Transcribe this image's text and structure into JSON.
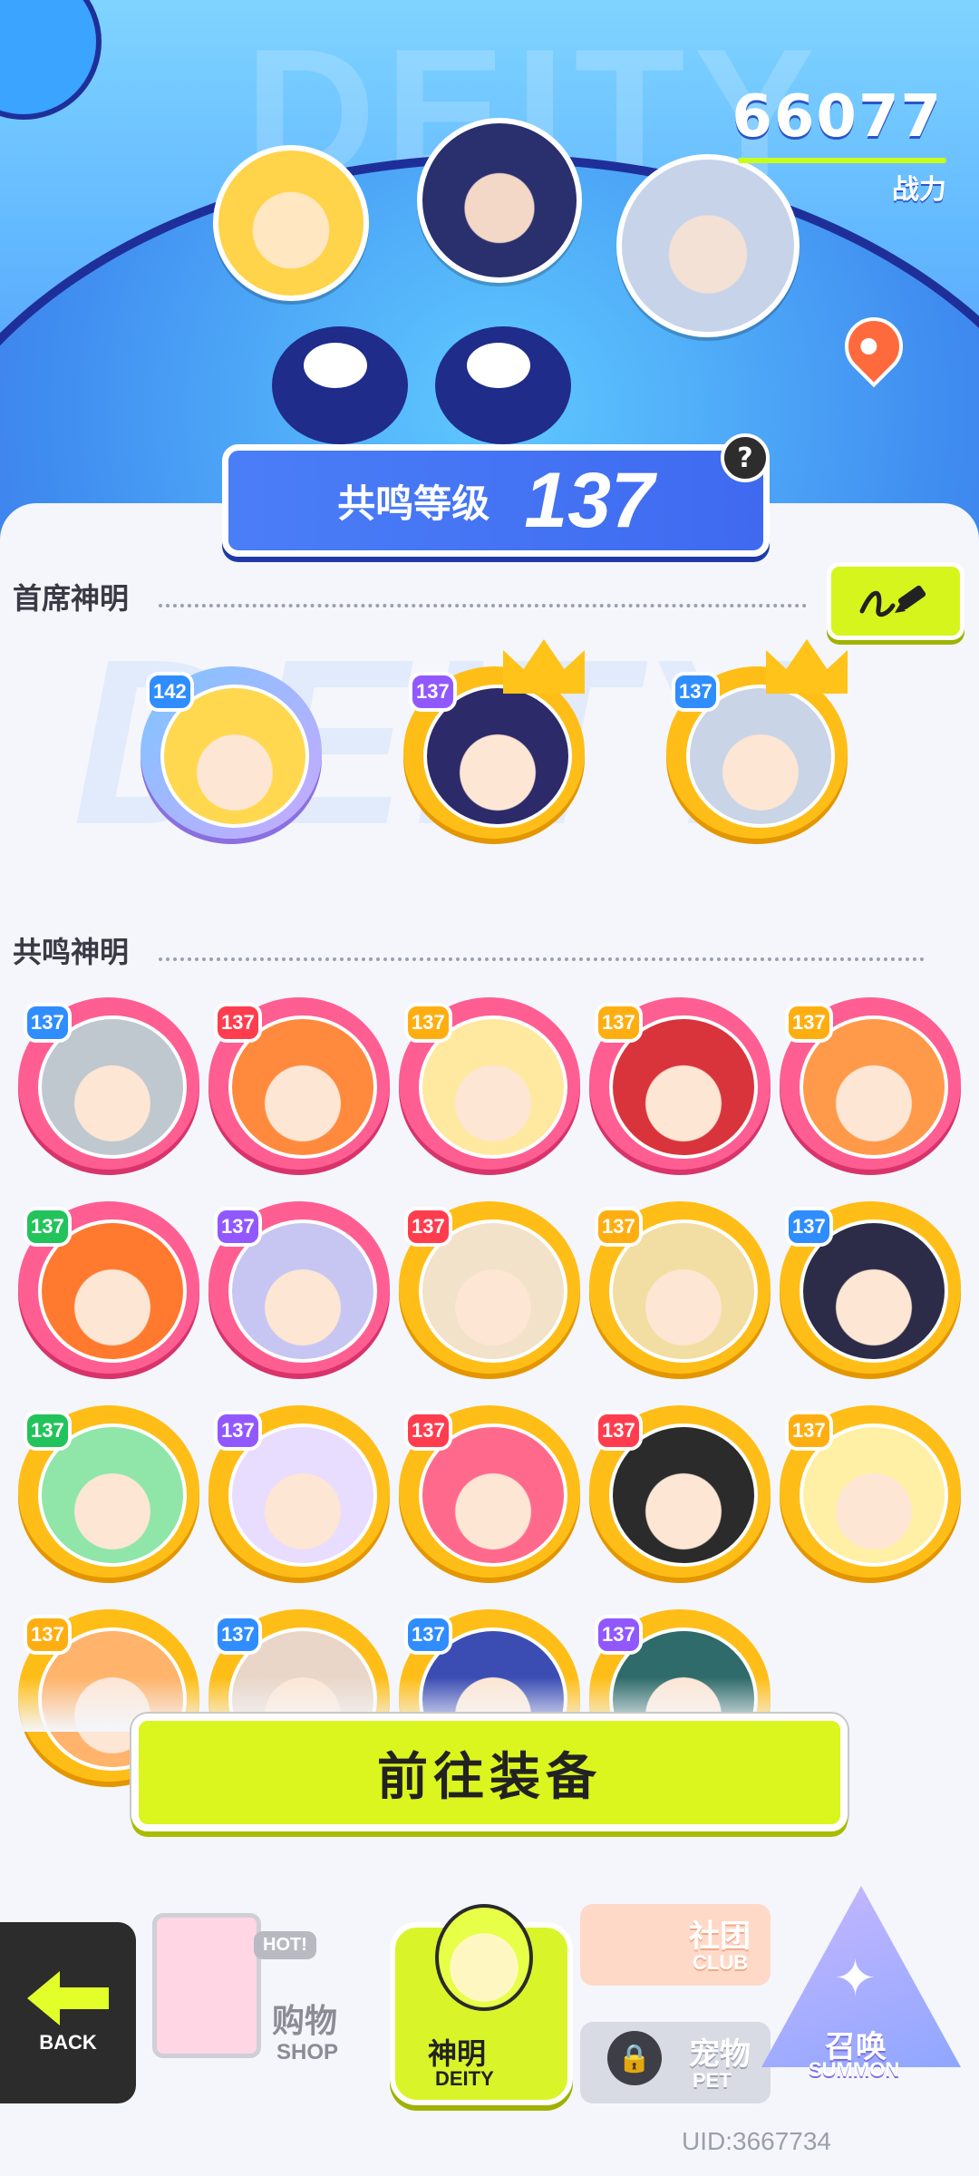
{
  "header": {
    "power_value": "66077",
    "power_label": "战力",
    "background_word": "DEITY"
  },
  "resonance": {
    "label": "共鸣等级",
    "level": "137"
  },
  "chief": {
    "title": "首席神明",
    "cards": [
      {
        "level": "142",
        "frame": "violet",
        "badge": "blue",
        "crown": false,
        "portrait_color": "#ffd84f"
      },
      {
        "level": "137",
        "frame": "gold",
        "badge": "purple",
        "crown": true,
        "portrait_color": "#2d2a6a"
      },
      {
        "level": "137",
        "frame": "gold",
        "badge": "blue",
        "crown": true,
        "portrait_color": "#c9d4e6"
      }
    ]
  },
  "resonance_section": {
    "title": "共鸣神明",
    "cards": [
      {
        "level": "137",
        "frame": "pink",
        "badge": "blue",
        "portrait_color": "#bfc7cf"
      },
      {
        "level": "137",
        "frame": "pink",
        "badge": "red",
        "portrait_color": "#ff8a3d"
      },
      {
        "level": "137",
        "frame": "pink",
        "badge": "gold",
        "portrait_color": "#ffe9a0"
      },
      {
        "level": "137",
        "frame": "pink",
        "badge": "gold",
        "portrait_color": "#d9343c"
      },
      {
        "level": "137",
        "frame": "pink",
        "badge": "gold",
        "portrait_color": "#ff9a4a"
      },
      {
        "level": "137",
        "frame": "pink",
        "badge": "green",
        "portrait_color": "#ff7a2e"
      },
      {
        "level": "137",
        "frame": "pink",
        "badge": "purple",
        "portrait_color": "#c7c6f2"
      },
      {
        "level": "137",
        "frame": "gold",
        "badge": "red",
        "portrait_color": "#f1e2c9"
      },
      {
        "level": "137",
        "frame": "gold",
        "badge": "gold",
        "portrait_color": "#f2dea2"
      },
      {
        "level": "137",
        "frame": "gold",
        "badge": "blue",
        "portrait_color": "#2c2c48"
      },
      {
        "level": "137",
        "frame": "gold",
        "badge": "green",
        "portrait_color": "#8fe6a8"
      },
      {
        "level": "137",
        "frame": "gold",
        "badge": "purple",
        "portrait_color": "#e8dcff"
      },
      {
        "level": "137",
        "frame": "gold",
        "badge": "red",
        "portrait_color": "#ff6a8c"
      },
      {
        "level": "137",
        "frame": "gold",
        "badge": "red",
        "portrait_color": "#2b2b2b"
      },
      {
        "level": "137",
        "frame": "gold",
        "badge": "gold",
        "portrait_color": "#fff0a6"
      },
      {
        "level": "137",
        "frame": "gold",
        "badge": "gold",
        "portrait_color": "#ffb36b"
      },
      {
        "level": "137",
        "frame": "gold",
        "badge": "blue",
        "portrait_color": "#e9d6c8"
      },
      {
        "level": "137",
        "frame": "gold",
        "badge": "blue",
        "portrait_color": "#3b4db3"
      },
      {
        "level": "137",
        "frame": "gold",
        "badge": "purple",
        "portrait_color": "#2f6b6a"
      }
    ]
  },
  "equip_button": {
    "label": "前往装备"
  },
  "nav": {
    "back": {
      "label": "BACK"
    },
    "shop": {
      "label": "购物",
      "sub": "SHOP",
      "hot": "HOT!"
    },
    "deity": {
      "label": "神明",
      "sub": "DEITY"
    },
    "club": {
      "label": "社团",
      "sub": "CLUB"
    },
    "pet": {
      "label": "宠物",
      "sub": "PET"
    },
    "summon": {
      "label": "召唤",
      "sub": "SUMMON"
    }
  },
  "uid": "UID:3667734",
  "colors": {
    "accent_lime": "#d6f51c",
    "pink_frame": "#ff5e92",
    "gold_frame": "#ffbe17",
    "sky_blue": "#62b8ff"
  }
}
